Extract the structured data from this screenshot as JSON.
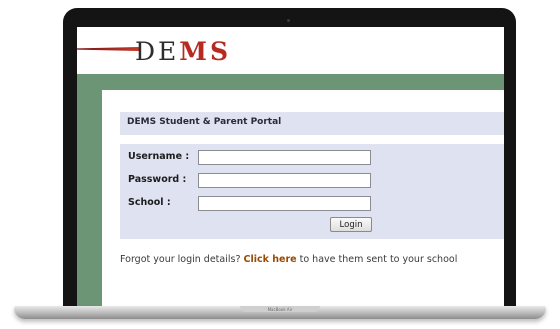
{
  "app": {
    "logo": {
      "d": "D",
      "e": "E",
      "m": "M",
      "s": "S"
    },
    "brand_color": "#b62a21",
    "accent_green": "#6b9575",
    "panel_color": "#dfe2f1"
  },
  "portal": {
    "title": "DEMS Student & Parent Portal"
  },
  "form": {
    "username_label": "Username :",
    "password_label": "Password :",
    "school_label": "School :",
    "username_value": "",
    "password_value": "",
    "school_value": "",
    "login_label": "Login"
  },
  "footer": {
    "forgot_prefix": "Forgot your login details? ",
    "forgot_link": "Click here",
    "forgot_suffix": " to have them sent to your school"
  },
  "device": {
    "label": "MacBook Air"
  }
}
